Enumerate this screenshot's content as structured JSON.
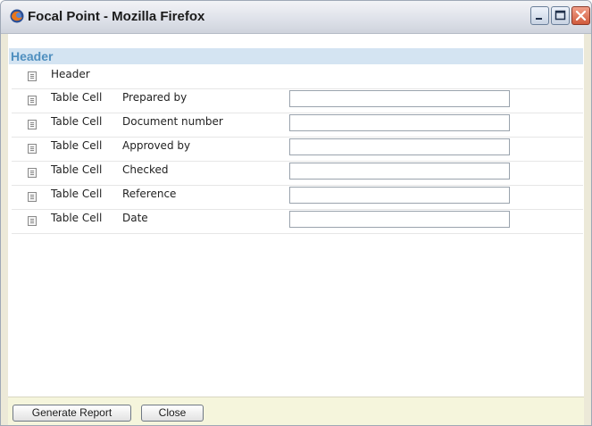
{
  "window": {
    "title": "Focal Point - Mozilla Firefox",
    "icon": "firefox-icon"
  },
  "section": {
    "title": "Header"
  },
  "rows": [
    {
      "type": "Header",
      "label": "",
      "value": ""
    },
    {
      "type": "Table Cell",
      "label": "Prepared by",
      "value": ""
    },
    {
      "type": "Table Cell",
      "label": "Document number",
      "value": ""
    },
    {
      "type": "Table Cell",
      "label": "Approved by",
      "value": ""
    },
    {
      "type": "Table Cell",
      "label": "Checked",
      "value": ""
    },
    {
      "type": "Table Cell",
      "label": "Reference",
      "value": ""
    },
    {
      "type": "Table Cell",
      "label": "Date",
      "value": ""
    }
  ],
  "footer": {
    "generate_label": "Generate Report",
    "close_label": "Close"
  },
  "colors": {
    "section_header_bg": "#d4e4f2",
    "section_title": "#4f8fbf",
    "footer_bg": "#f5f5dc"
  }
}
